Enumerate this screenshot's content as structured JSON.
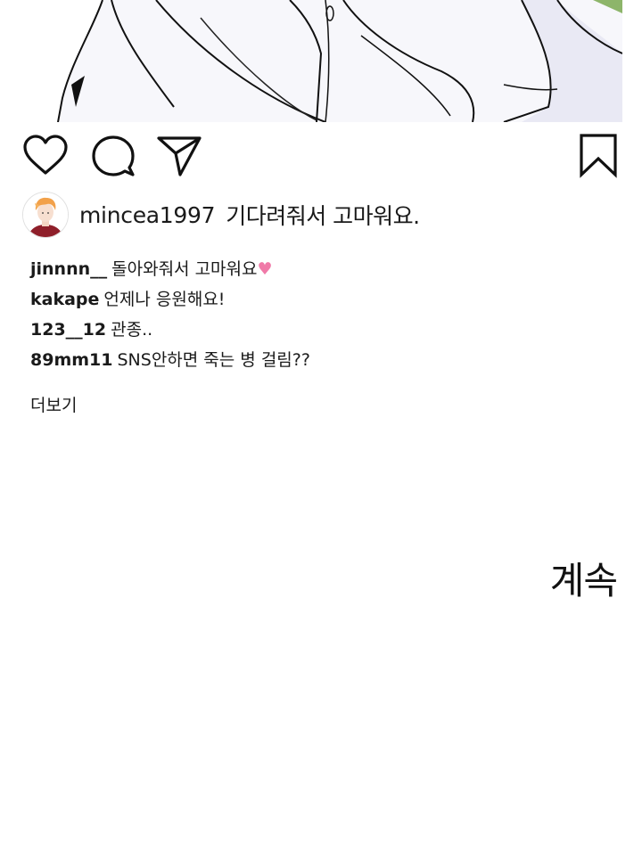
{
  "post": {
    "actions": {
      "like_icon": "heart-outline-icon",
      "comment_icon": "speech-bubble-icon",
      "share_icon": "paper-plane-icon",
      "save_icon": "bookmark-icon"
    },
    "caption": {
      "username": "mincea1997",
      "text": "기다려줘서 고마워요."
    }
  },
  "comments": [
    {
      "username": "jinnnn__",
      "text": "돌아와줘서 고마워요"
    },
    {
      "username": "kakape",
      "text": "언제나 응원해요!"
    },
    {
      "username": "123__12",
      "text": "관종.."
    },
    {
      "username": "89mm11",
      "text": "SNS안하면 죽는 병 걸림??"
    }
  ],
  "more_label": "더보기",
  "continue_label": "계속",
  "colors": {
    "heart_accent": "#f07aa8",
    "text": "#1a1a1a"
  }
}
